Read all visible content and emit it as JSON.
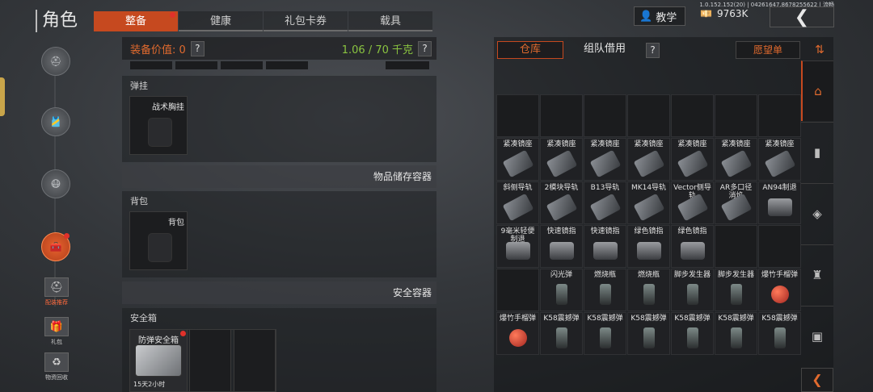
{
  "build_info": "1.0.152.152(20) | 04261647.8678255622 | 流畅",
  "header": {
    "title": "角色",
    "tabs": [
      {
        "label": "整备",
        "active": true,
        "badge": true
      },
      {
        "label": "健康",
        "active": false,
        "badge": false
      },
      {
        "label": "礼包卡券",
        "active": false,
        "badge": false
      },
      {
        "label": "载具",
        "active": false,
        "badge": false
      }
    ],
    "tutorial_label": "教学",
    "currency": "9763K",
    "back_icon": "chevron-left-icon"
  },
  "left_nav": {
    "mini_items": [
      {
        "label": "配装推荐",
        "icon": "helmet-icon",
        "highlight": true
      },
      {
        "label": "礼包",
        "icon": "gift-icon",
        "highlight": false
      },
      {
        "label": "物资回收",
        "icon": "recycle-icon",
        "highlight": false
      }
    ]
  },
  "equipment": {
    "value_label": "装备价值: 0",
    "weight": "1.06 / 70 千克",
    "sections": {
      "vest": {
        "title": "弹挂",
        "slot_label": "战术胸挂"
      },
      "storage_divider": "物品储存容器",
      "backpack": {
        "title": "背包",
        "slot_label": "背包"
      },
      "safe_divider": "安全容器",
      "safebox": {
        "title": "安全箱",
        "slot_label": "防弹安全箱",
        "timer": "15天2小时",
        "badge": true
      }
    }
  },
  "storage": {
    "tabs": [
      "仓库",
      "组队借用"
    ],
    "wishlist_label": "愿望单",
    "sort_icon": "sort-icon",
    "grid_rows": [
      [
        {
          "name": ""
        },
        {
          "name": ""
        },
        {
          "name": ""
        },
        {
          "name": ""
        },
        {
          "name": ""
        },
        {
          "name": ""
        },
        {
          "name": ""
        }
      ],
      [
        {
          "name": "紧凑镜座"
        },
        {
          "name": "紧凑镜座"
        },
        {
          "name": "紧凑镜座"
        },
        {
          "name": "紧凑镜座"
        },
        {
          "name": "紧凑镜座"
        },
        {
          "name": "紧凑镜座"
        },
        {
          "name": "紧凑镜座"
        }
      ],
      [
        {
          "name": "斜侧导轨"
        },
        {
          "name": "2模块导轨"
        },
        {
          "name": "B13导轨"
        },
        {
          "name": "MK14导轨"
        },
        {
          "name": "Vector侧导轨"
        },
        {
          "name": "AR多口径消焰"
        },
        {
          "name": "AN94制退"
        }
      ],
      [
        {
          "name": "9毫米轻便制退"
        },
        {
          "name": "快速镜指"
        },
        {
          "name": "快速镜指"
        },
        {
          "name": "绿色镜指"
        },
        {
          "name": "绿色镜指"
        },
        {
          "name": ""
        },
        {
          "name": ""
        }
      ],
      [
        {
          "name": ""
        },
        {
          "name": "闪光弹"
        },
        {
          "name": "燃烧瓶"
        },
        {
          "name": "燃烧瓶"
        },
        {
          "name": "脚步发生器"
        },
        {
          "name": "脚步发生器"
        },
        {
          "name": "爆竹手榴弹"
        }
      ],
      [
        {
          "name": "爆竹手榴弹"
        },
        {
          "name": "K58震撼弹"
        },
        {
          "name": "K58震撼弹"
        },
        {
          "name": "K58震撼弹"
        },
        {
          "name": "K58震撼弹"
        },
        {
          "name": "K58震撼弹"
        },
        {
          "name": "K58震撼弹"
        }
      ]
    ],
    "right_nav": [
      "home-icon",
      "ammo-icon",
      "box-icon",
      "armor-icon",
      "chat-icon"
    ],
    "collapse_icon": "chevron-left-icon"
  }
}
